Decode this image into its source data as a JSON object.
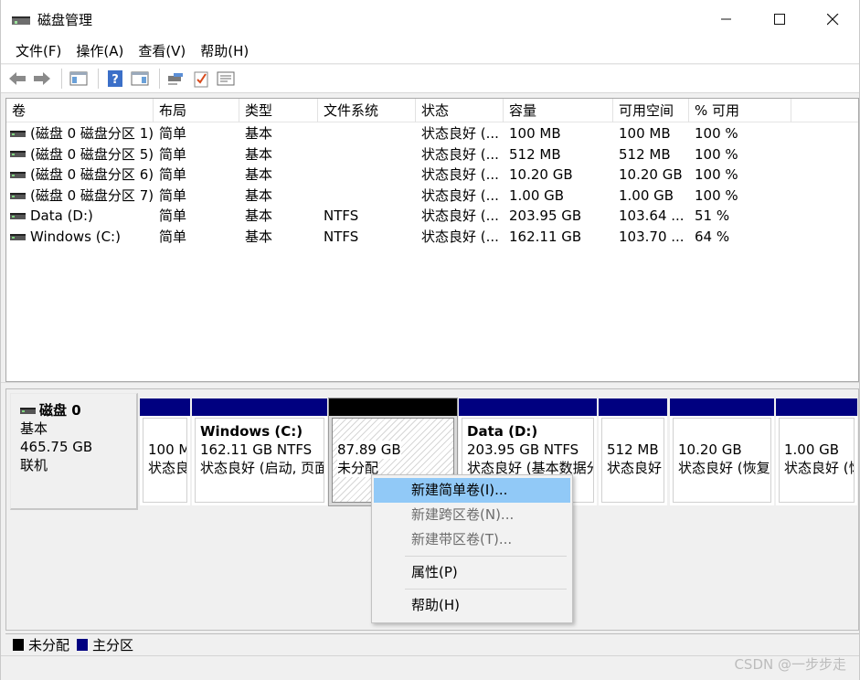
{
  "window": {
    "title": "磁盘管理",
    "controls": {
      "minimize": "—",
      "maximize": "☐",
      "close": "✕"
    }
  },
  "menu": [
    "文件(F)",
    "操作(A)",
    "查看(V)",
    "帮助(H)"
  ],
  "toolbar": {
    "icons": [
      "back-icon",
      "forward-icon",
      "panel-icon",
      "help-icon",
      "panel-2-icon",
      "connect-icon",
      "checklist-icon",
      "properties-icon"
    ]
  },
  "volume_table": {
    "columns": [
      "卷",
      "布局",
      "类型",
      "文件系统",
      "状态",
      "容量",
      "可用空间",
      "% 可用"
    ],
    "rows": [
      [
        "(磁盘 0 磁盘分区 1)",
        "简单",
        "基本",
        "",
        "状态良好 (...",
        "100 MB",
        "100 MB",
        "100 %"
      ],
      [
        "(磁盘 0 磁盘分区 5)",
        "简单",
        "基本",
        "",
        "状态良好 (...",
        "512 MB",
        "512 MB",
        "100 %"
      ],
      [
        "(磁盘 0 磁盘分区 6)",
        "简单",
        "基本",
        "",
        "状态良好 (...",
        "10.20 GB",
        "10.20 GB",
        "100 %"
      ],
      [
        "(磁盘 0 磁盘分区 7)",
        "简单",
        "基本",
        "",
        "状态良好 (...",
        "1.00 GB",
        "1.00 GB",
        "100 %"
      ],
      [
        "Data (D:)",
        "简单",
        "基本",
        "NTFS",
        "状态良好 (...",
        "203.95 GB",
        "103.64 ...",
        "51 %"
      ],
      [
        "Windows (C:)",
        "简单",
        "基本",
        "NTFS",
        "状态良好 (...",
        "162.11 GB",
        "103.70 ...",
        "64 %"
      ]
    ]
  },
  "disk": {
    "name": "磁盘 0",
    "type": "基本",
    "size": "465.75 GB",
    "status": "联机"
  },
  "partitions": [
    {
      "title": "",
      "line1": "100 M",
      "line2": "状态良"
    },
    {
      "title": "Windows  (C:)",
      "line1": "162.11 GB NTFS",
      "line2": "状态良好 (启动, 页面"
    },
    {
      "title": "",
      "line1": "87.89 GB",
      "line2": "未分配"
    },
    {
      "title": "Data  (D:)",
      "line1": "203.95 GB NTFS",
      "line2": "状态良好 (基本数据分"
    },
    {
      "title": "",
      "line1": "512 MB",
      "line2": "状态良好"
    },
    {
      "title": "",
      "line1": "10.20 GB",
      "line2": "状态良好 (恢复"
    },
    {
      "title": "",
      "line1": "1.00 GB",
      "line2": "状态良好 (恢"
    }
  ],
  "context_menu": {
    "items": [
      "新建简单卷(I)...",
      "新建跨区卷(N)...",
      "新建带区卷(T)...",
      "属性(P)",
      "帮助(H)"
    ]
  },
  "legend": {
    "unallocated": "未分配",
    "primary": "主分区",
    "colors": {
      "unallocated": "#000000",
      "primary": "#000080"
    }
  },
  "watermark": "CSDN @一步步走"
}
